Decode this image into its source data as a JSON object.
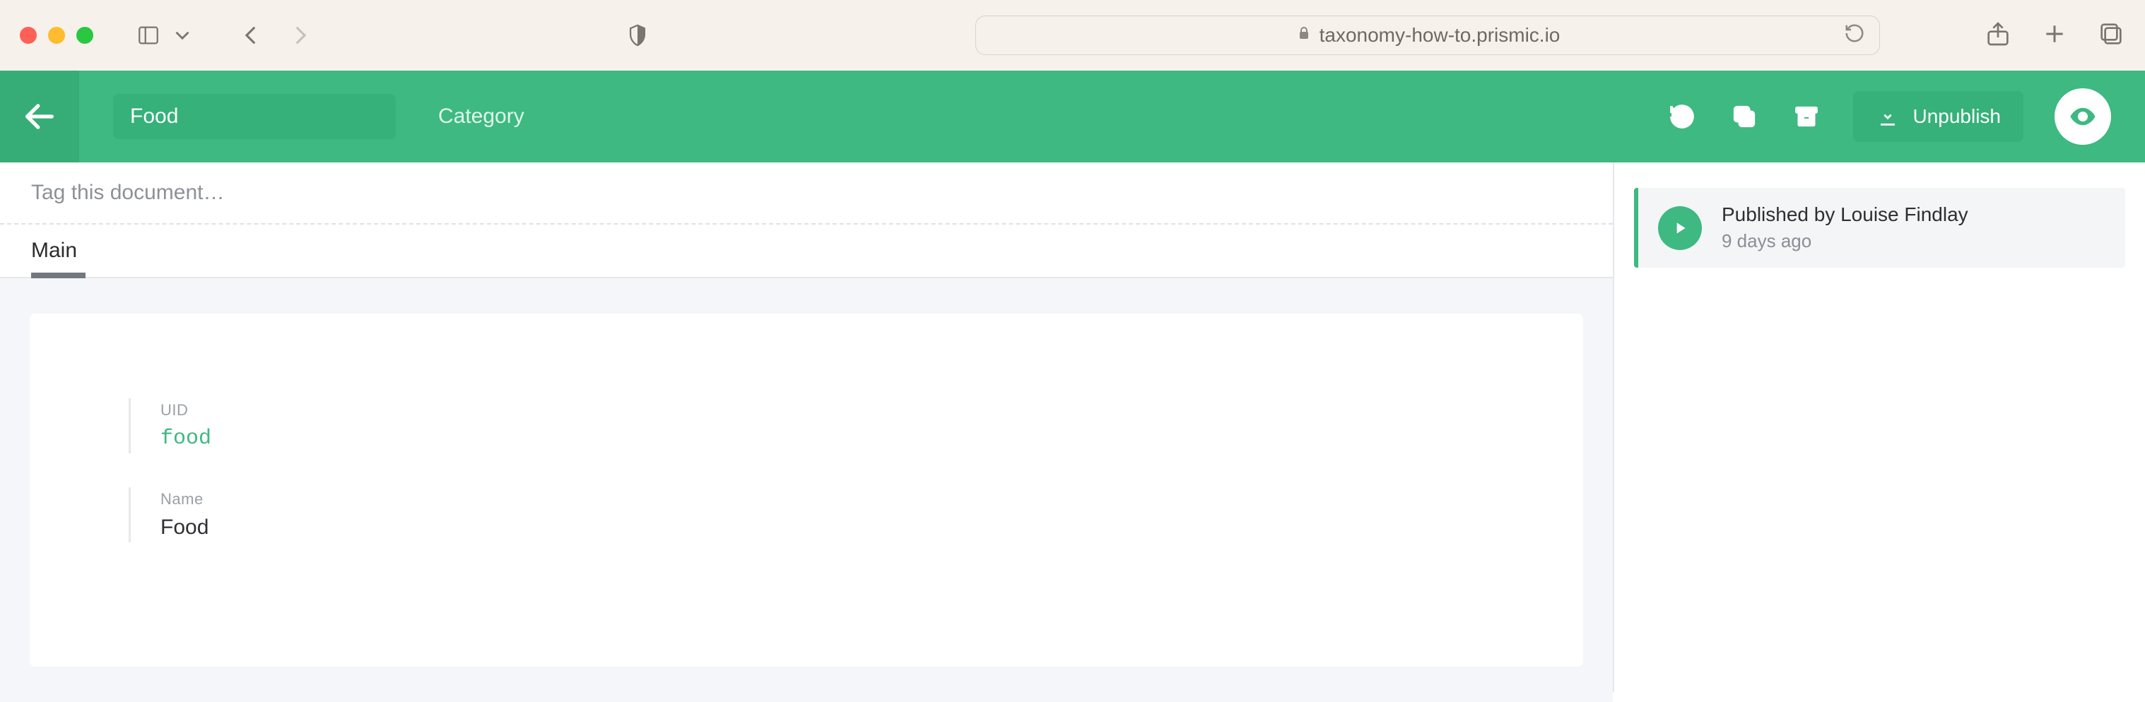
{
  "browser": {
    "url": "taxonomy-how-to.prismic.io"
  },
  "toolbar": {
    "title": "Food",
    "doc_type": "Category",
    "unpublish_label": "Unpublish"
  },
  "tags": {
    "placeholder": "Tag this document…"
  },
  "tabs": [
    {
      "label": "Main",
      "active": true
    }
  ],
  "fields": {
    "uid": {
      "label": "UID",
      "value": "food"
    },
    "name": {
      "label": "Name",
      "value": "Food"
    }
  },
  "history": {
    "status_line": "Published by Louise Findlay",
    "time": "9 days ago"
  }
}
